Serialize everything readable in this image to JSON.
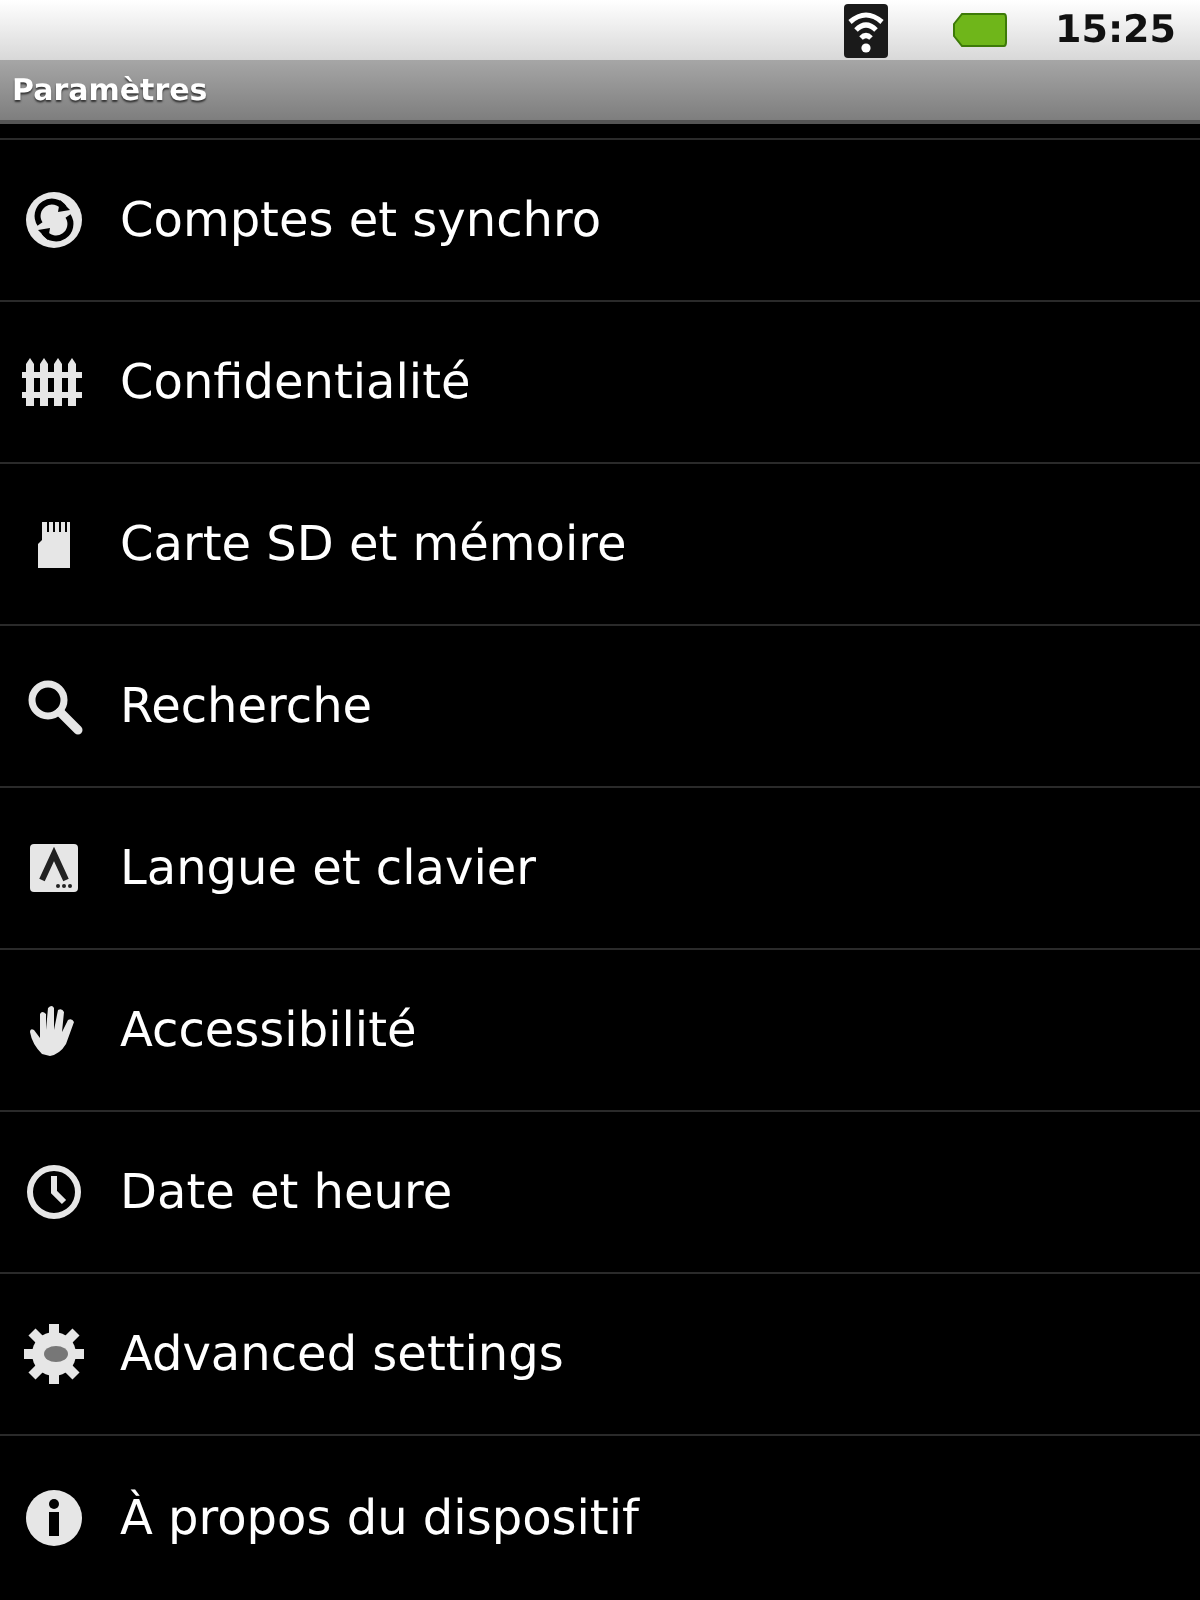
{
  "status_bar": {
    "time": "15:25"
  },
  "title_bar": {
    "title": "Paramètres"
  },
  "items": [
    {
      "kind": "sync",
      "label": "Comptes et synchro"
    },
    {
      "kind": "privacy",
      "label": "Confidentialité"
    },
    {
      "kind": "sdcard",
      "label": "Carte SD et mémoire"
    },
    {
      "kind": "search",
      "label": "Recherche"
    },
    {
      "kind": "language",
      "label": "Langue et clavier"
    },
    {
      "kind": "accessibility",
      "label": "Accessibilité"
    },
    {
      "kind": "clock",
      "label": "Date et heure"
    },
    {
      "kind": "gear",
      "label": "Advanced settings"
    },
    {
      "kind": "info",
      "label": "À propos du dispositif"
    }
  ]
}
